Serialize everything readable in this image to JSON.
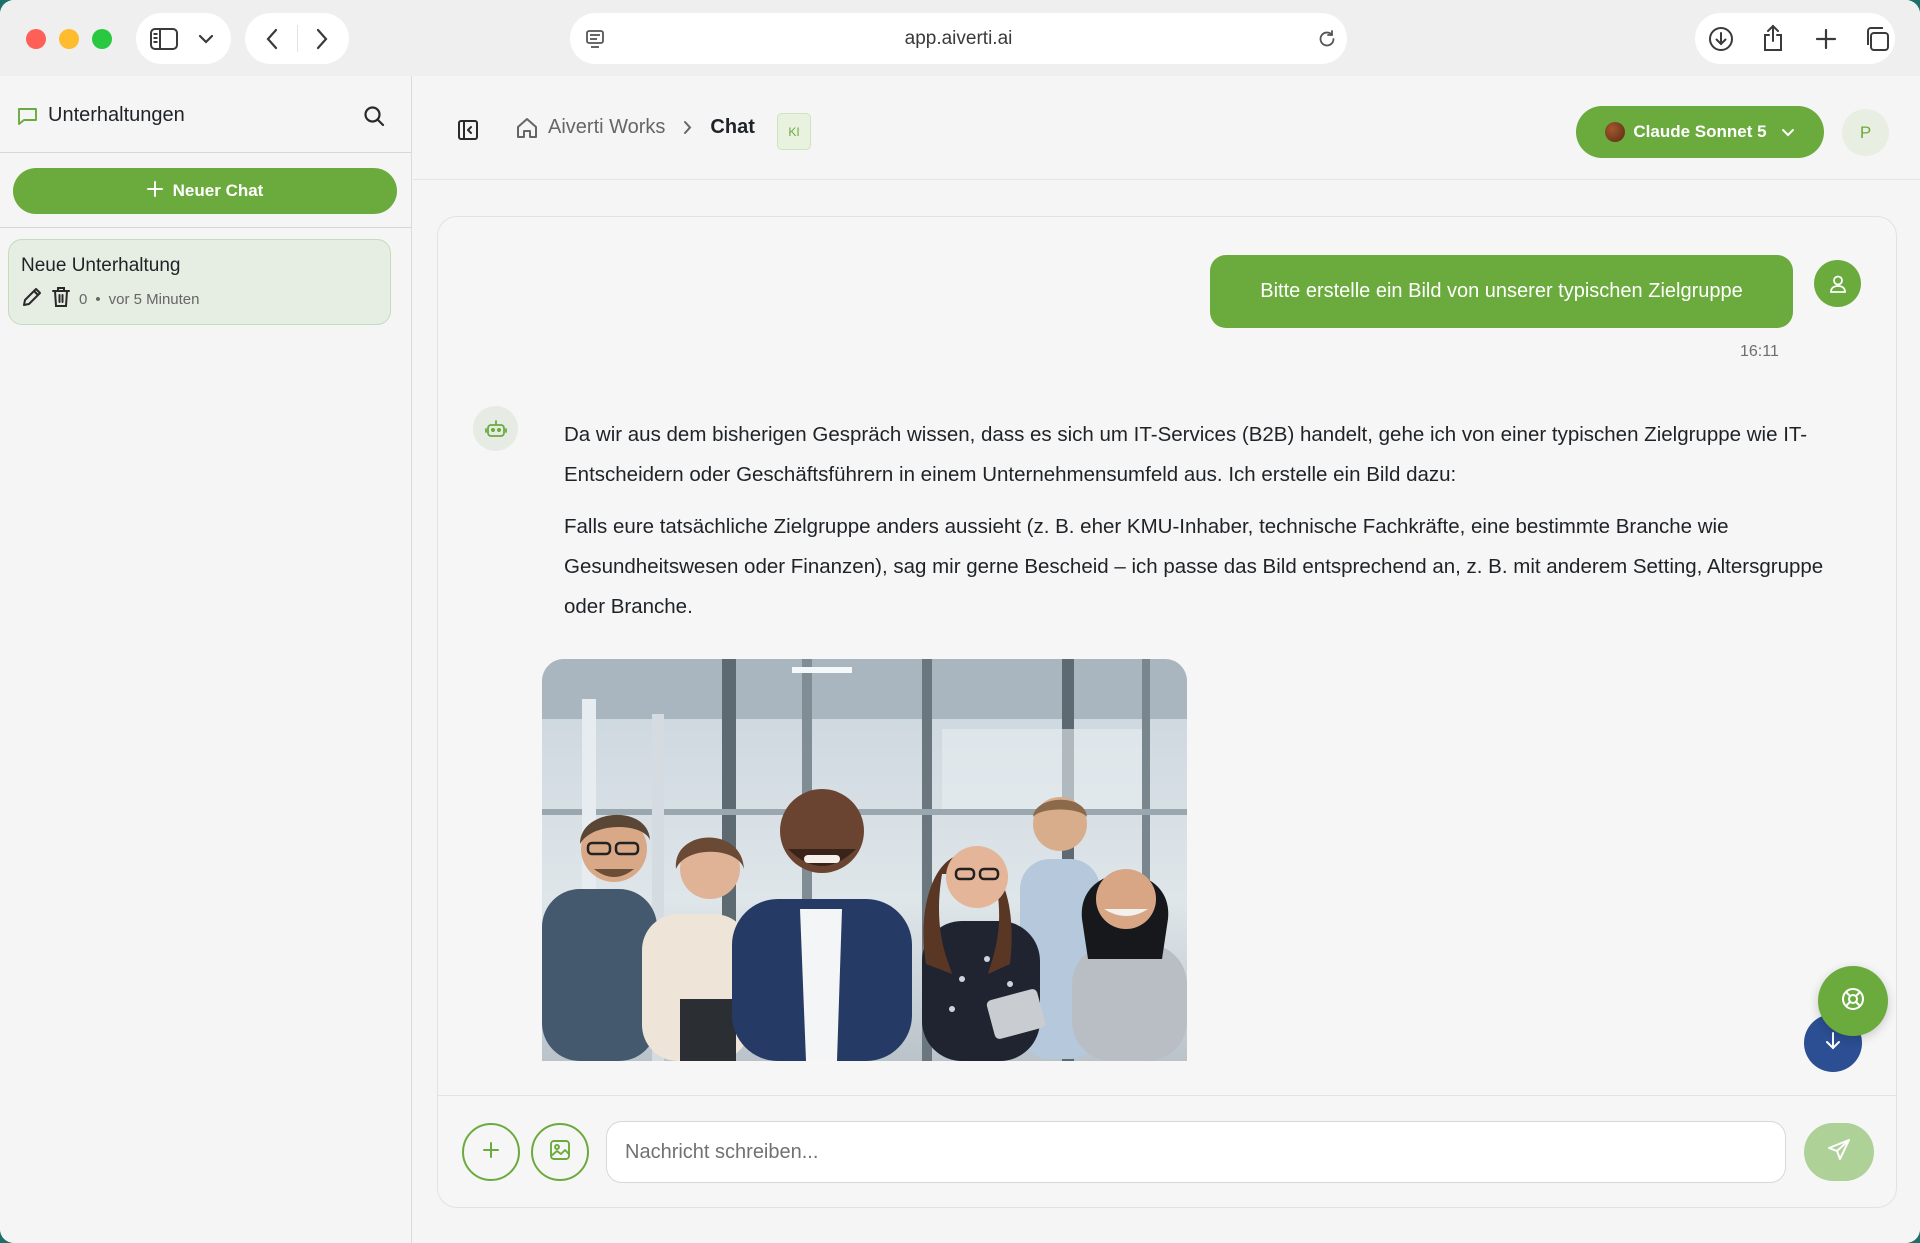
{
  "browser": {
    "url": "app.aiverti.ai",
    "icons": [
      "sidebar-toggle-icon",
      "chevron-down-icon",
      "back-icon",
      "forward-icon",
      "page-icon",
      "reload-icon",
      "download-icon",
      "share-icon",
      "new-tab-icon",
      "tabs-overview-icon"
    ]
  },
  "sidebar": {
    "title": "Unterhaltungen",
    "new_chat_label": "Neuer Chat",
    "conversations": [
      {
        "title": "Neue Unterhaltung",
        "count": "0",
        "time": "vor 5 Minuten"
      }
    ]
  },
  "header": {
    "breadcrumb_home": "Aiverti Works",
    "breadcrumb_current": "Chat",
    "badge": "KI",
    "model": "Claude Sonnet 5",
    "avatar_initial": "P"
  },
  "chat": {
    "messages": [
      {
        "role": "user",
        "text": "Bitte erstelle ein Bild von unserer typischen Zielgruppe",
        "time": "16:11"
      },
      {
        "role": "assistant",
        "paragraphs": [
          "Da wir aus dem bisherigen Gespräch wissen, dass es sich um IT-Services (B2B) handelt, gehe ich von einer typischen Zielgruppe wie IT-Entscheidern oder Geschäftsführern in einem Unternehmensumfeld aus. Ich erstelle ein Bild dazu:",
          "Falls eure tatsächliche Zielgruppe anders aussieht (z. B. eher KMU-Inhaber, technische Fachkräfte, eine bestimmte Branche wie Gesundheitswesen oder Finanzen), sag mir gerne Bescheid – ich passe das Bild entsprechend an, z. B. mit anderem Setting, Altersgruppe oder Branche."
        ]
      }
    ]
  },
  "composer": {
    "placeholder": "Nachricht schreiben..."
  },
  "colors": {
    "accent": "#6bab3e",
    "accent_light": "#aed197",
    "fab_blue": "#2c4f93"
  }
}
